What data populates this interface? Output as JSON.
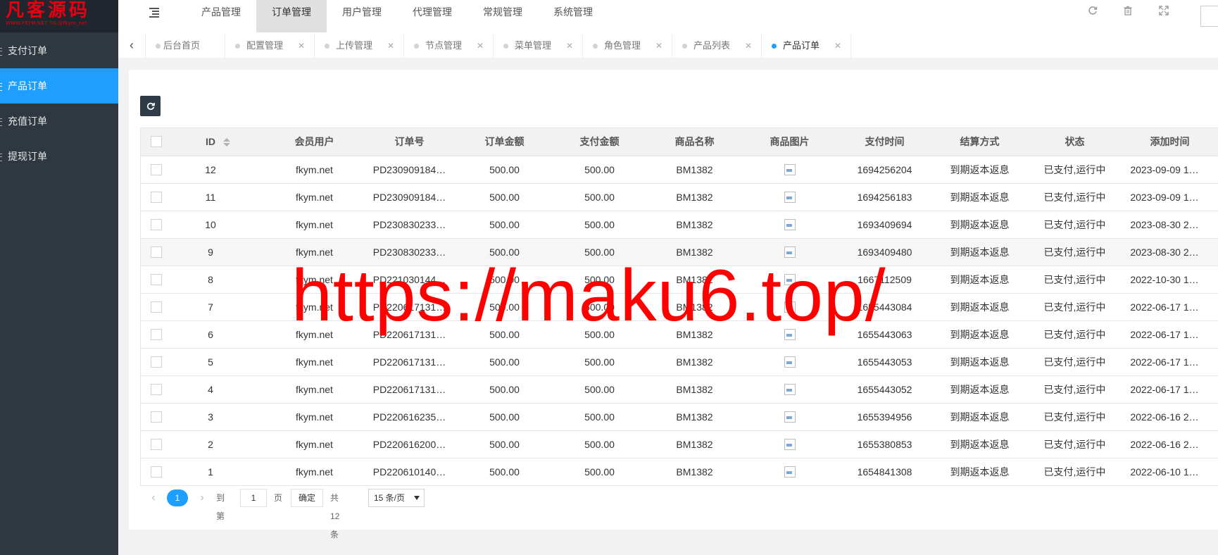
{
  "logo": {
    "text": "凡客源码",
    "sub": "WWW.FKYM.NET    TG:@fkym_net"
  },
  "sidebar": {
    "items": [
      {
        "label": "支付订单"
      },
      {
        "label": "产品订单"
      },
      {
        "label": "充值订单"
      },
      {
        "label": "提现订单"
      }
    ]
  },
  "header": {
    "nav": [
      {
        "label": "产品管理"
      },
      {
        "label": "订单管理"
      },
      {
        "label": "用户管理"
      },
      {
        "label": "代理管理"
      },
      {
        "label": "常规管理"
      },
      {
        "label": "系统管理"
      }
    ],
    "icons": {
      "refresh": "refresh-icon",
      "clear": "trash-icon",
      "fullscreen": "fullscreen-icon"
    }
  },
  "tabs": [
    {
      "label": "后台首页"
    },
    {
      "label": "配置管理"
    },
    {
      "label": "上传管理"
    },
    {
      "label": "节点管理"
    },
    {
      "label": "菜单管理"
    },
    {
      "label": "角色管理"
    },
    {
      "label": "产品列表"
    },
    {
      "label": "产品订单"
    }
  ],
  "table": {
    "headers": [
      "ID",
      "会员用户",
      "订单号",
      "订单金额",
      "支付金额",
      "商品名称",
      "商品图片",
      "支付时间",
      "结算方式",
      "状态",
      "添加时间"
    ],
    "rows": [
      [
        "12",
        "fkym.net",
        "PD230909184…",
        "500.00",
        "500.00",
        "BM1382",
        "",
        "1694256204",
        "到期返本返息",
        "已支付,运行中",
        "2023-09-09 1…"
      ],
      [
        "11",
        "fkym.net",
        "PD230909184…",
        "500.00",
        "500.00",
        "BM1382",
        "",
        "1694256183",
        "到期返本返息",
        "已支付,运行中",
        "2023-09-09 1…"
      ],
      [
        "10",
        "fkym.net",
        "PD230830233…",
        "500.00",
        "500.00",
        "BM1382",
        "",
        "1693409694",
        "到期返本返息",
        "已支付,运行中",
        "2023-08-30 2…"
      ],
      [
        "9",
        "fkym.net",
        "PD230830233…",
        "500.00",
        "500.00",
        "BM1382",
        "",
        "1693409480",
        "到期返本返息",
        "已支付,运行中",
        "2023-08-30 2…"
      ],
      [
        "8",
        "fkym.net",
        "PD221030144…",
        "500.00",
        "500.00",
        "BM1382",
        "",
        "1667112509",
        "到期返本返息",
        "已支付,运行中",
        "2022-10-30 1…"
      ],
      [
        "7",
        "fkym.net",
        "PD220617131…",
        "500.00",
        "500.00",
        "BM1382",
        "",
        "1655443084",
        "到期返本返息",
        "已支付,运行中",
        "2022-06-17 1…"
      ],
      [
        "6",
        "fkym.net",
        "PD220617131…",
        "500.00",
        "500.00",
        "BM1382",
        "",
        "1655443063",
        "到期返本返息",
        "已支付,运行中",
        "2022-06-17 1…"
      ],
      [
        "5",
        "fkym.net",
        "PD220617131…",
        "500.00",
        "500.00",
        "BM1382",
        "",
        "1655443053",
        "到期返本返息",
        "已支付,运行中",
        "2022-06-17 1…"
      ],
      [
        "4",
        "fkym.net",
        "PD220617131…",
        "500.00",
        "500.00",
        "BM1382",
        "",
        "1655443052",
        "到期返本返息",
        "已支付,运行中",
        "2022-06-17 1…"
      ],
      [
        "3",
        "fkym.net",
        "PD220616235…",
        "500.00",
        "500.00",
        "BM1382",
        "",
        "1655394956",
        "到期返本返息",
        "已支付,运行中",
        "2022-06-16 2…"
      ],
      [
        "2",
        "fkym.net",
        "PD220616200…",
        "500.00",
        "500.00",
        "BM1382",
        "",
        "1655380853",
        "到期返本返息",
        "已支付,运行中",
        "2022-06-16 2…"
      ],
      [
        "1",
        "fkym.net",
        "PD220610140…",
        "500.00",
        "500.00",
        "BM1382",
        "",
        "1654841308",
        "到期返本返息",
        "已支付,运行中",
        "2022-06-10 1…"
      ]
    ]
  },
  "pager": {
    "current": "1",
    "goto_label": "到第",
    "goto_value": "1",
    "page_unit": "页",
    "confirm": "确定",
    "total": "共 12 条",
    "per_page": "15 条/页"
  },
  "watermark": "https://maku6.top/",
  "colors": {
    "accent": "#1e9fff",
    "sidebar": "#2f3740",
    "watermark": "#ff0000"
  }
}
